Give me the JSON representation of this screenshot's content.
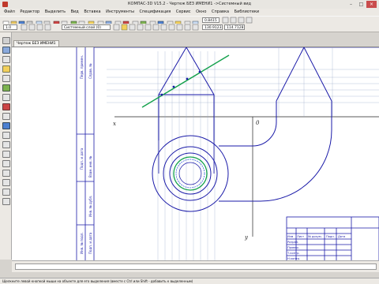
{
  "window": {
    "title": "КОМПАС-3D V15.2 - Чертеж БЕЗ ИМЕНИ1 ->Системный вид"
  },
  "menu": {
    "items": [
      "Файл",
      "Редактор",
      "Выделить",
      "Вид",
      "Вставка",
      "Инструменты",
      "Спецификация",
      "Сервис",
      "Окно",
      "Справка",
      "Библиотеки"
    ]
  },
  "toolbar": {
    "zoom": "0.8415",
    "step": "1.0",
    "coords": "130.9123",
    "coord_y": "114.7128",
    "layer": "Системный слой (0)"
  },
  "tabs": [
    "Чертеж БЕЗ ИМЕНИ1"
  ],
  "drawing": {
    "axis_x": "x",
    "axis_label_0": "0",
    "axis_y": "y",
    "stamp_labels": [
      "Изм",
      "Лист",
      "№ докум.",
      "Подп.",
      "Дата",
      "Разраб.",
      "Провер.",
      "Т.контр.",
      "Н.контр.",
      "Утв."
    ],
    "frame_labels": [
      "Перв. примен.",
      "Справ. №",
      "Подп. и дата",
      "Инв. № дубл.",
      "Взам. инв. №",
      "Подп. и дата",
      "Инв. № подл."
    ]
  },
  "status": {
    "text": "Щелкните левой кнопкой мыши на объекте для его выделения (вместе с Ctrl или Shift - добавить к выделенным)"
  },
  "colors": {
    "construction": "#1a1aa8",
    "green_line": "#13a14b",
    "blue_hatch": "#3b63d6"
  }
}
